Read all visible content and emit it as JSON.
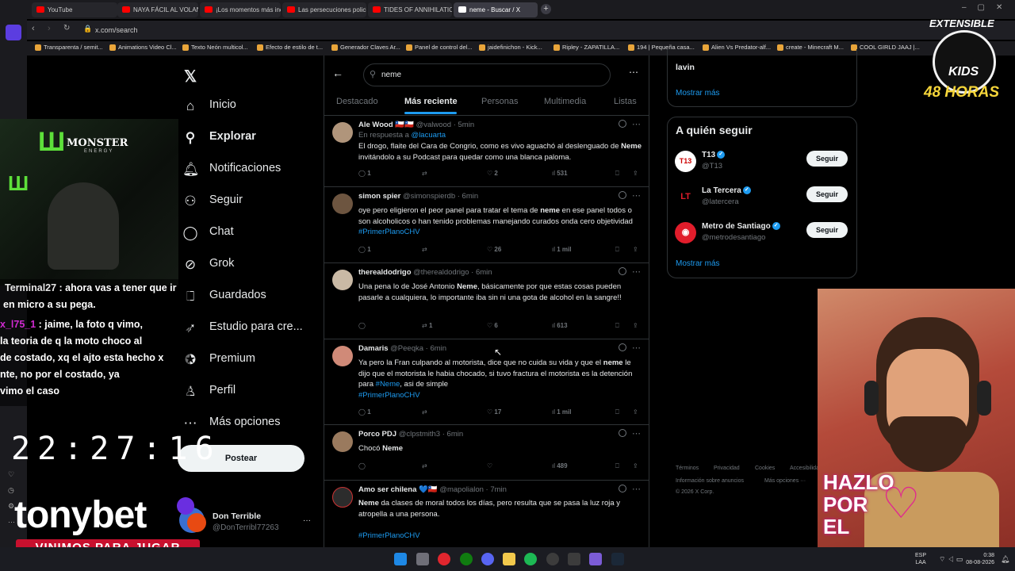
{
  "browser": {
    "tabs": [
      "YouTube",
      "NAYA FÁCIL AL VOLANTE",
      "¡Los momentos más incre",
      "Las persecuciones policial",
      "TIDES OF ANNIHILATION",
      "neme - Buscar / X"
    ],
    "url": "x.com/search",
    "bookmarks": [
      "Transparenta / semit...",
      "Animations Video Cl...",
      "Texto Neón multicol...",
      "Efecto de estilo de t...",
      "Generador Claves Ar...",
      "Panel de control del...",
      "jaidefinichon - Kick...",
      "Ripley - ZAPATILLA...",
      "194 | Pequeña casa...",
      "Alien Vs Predator-alf...",
      "create - Minecraft M...",
      "COOL GIRLD JAAJ |..."
    ]
  },
  "x_nav": {
    "items": [
      {
        "label": "Inicio",
        "icon": "home-icon"
      },
      {
        "label": "Explorar",
        "icon": "search-icon"
      },
      {
        "label": "Notificaciones",
        "icon": "bell-icon"
      },
      {
        "label": "Seguir",
        "icon": "follow-icon"
      },
      {
        "label": "Chat",
        "icon": "chat-icon"
      },
      {
        "label": "Grok",
        "icon": "grok-icon"
      },
      {
        "label": "Guardados",
        "icon": "bookmark-icon"
      },
      {
        "label": "Estudio para cre...",
        "icon": "rocket-icon"
      },
      {
        "label": "Premium",
        "icon": "premium-icon"
      },
      {
        "label": "Perfil",
        "icon": "person-icon"
      },
      {
        "label": "Más opciones",
        "icon": "more-icon"
      }
    ],
    "post_label": "Postear",
    "account_name": "Don Terrible",
    "account_handle": "@DonTerribl77263"
  },
  "search": {
    "query": "neme",
    "tabs": [
      "Destacado",
      "Más reciente",
      "Personas",
      "Multimedia",
      "Listas"
    ],
    "selected_tab": "Más reciente"
  },
  "tweets": [
    {
      "name": "Ale Wood 🇨🇱🇨🇱",
      "handle": "@valwood · 5min",
      "reply_to": "En respuesta a",
      "reply_handle": "@lacuarta",
      "text": "El drogo, flaite del Cara de Congrio, como es vivo aguachó al deslenguado de Neme invitándolo a su Podcast para quedar como una blanca paloma.",
      "replies": "1",
      "retweets": "",
      "likes": "2",
      "views": "531"
    },
    {
      "name": "simon spier",
      "handle": "@simonspierdb · 6min",
      "text": "oye pero eligieron el peor panel para tratar el tema de neme en ese panel todos o son alcoholicos o han tenido problemas manejando curados onda cero objetividad",
      "hashtag": "#PrimerPlanoCHV",
      "replies": "1",
      "retweets": "",
      "likes": "26",
      "views": "1 mil"
    },
    {
      "name": "therealdodrigo",
      "handle": "@therealdodrigo · 6min",
      "text": "Una pena lo de José Antonio Neme, básicamente por que estas cosas pueden pasarle a cualquiera, lo importante iba sin ni una gota de alcohol en la sangre!!",
      "replies": "",
      "retweets": "1",
      "likes": "6",
      "views": "613"
    },
    {
      "name": "Damaris",
      "handle": "@Peeqka · 6min",
      "text": "Ya pero la Fran culpando al motorista, dice que no cuida su vida y que el neme le dijo que el motorista le habia chocado, si tuvo fractura el motorista es la detención para #Neme, asi de simple",
      "hashtag": "#PrimerPlanoCHV",
      "replies": "1",
      "retweets": "",
      "likes": "17",
      "views": "1 mil"
    },
    {
      "name": "Porco PDJ",
      "handle": "@clpstmith3 · 6min",
      "text": "Chocó Neme",
      "replies": "",
      "retweets": "",
      "likes": "",
      "views": "489"
    },
    {
      "name": "Amo ser chilena 💙🇨🇱",
      "handle": "@mapolialon · 7min",
      "text": "Neme da clases de moral todos los días, pero resulta que se pasa la luz roja y atropella a una persona.",
      "hashtag": "#PrimerPlanoCHV"
    }
  ],
  "sidebar": {
    "top_text": "lavin",
    "show_more": "Mostrar más",
    "who_title": "A quién seguir",
    "who": [
      {
        "name": "T13",
        "handle": "@T13",
        "color": "#ffffff"
      },
      {
        "name": "La Tercera",
        "handle": "@latercera",
        "color": "#e11d2b"
      },
      {
        "name": "Metro de Santiago",
        "handle": "@metrodesantiago",
        "color": "#e11d2b"
      }
    ],
    "follow_label": "Seguir",
    "show_more2": "Mostrar más",
    "footer": [
      "Términos",
      "Privacidad",
      "Cookies",
      "Accesibilidad",
      "Información sobre anuncios",
      "Más opciones ···",
      "© 2026 X Corp."
    ]
  },
  "overlay": {
    "chat": [
      {
        "user": "Terminal27",
        "msg": " : ahora vas a tener que ir"
      },
      {
        "user": "",
        "msg": "en micro a su pega."
      },
      {
        "user": "x_l75_1",
        "msg": " : jaime, la foto q vimo,"
      },
      {
        "user": "",
        "msg": "la teoria de q la moto choco al"
      },
      {
        "user": "",
        "msg": "de costado, xq el ajto esta hecho x"
      },
      {
        "user": "",
        "msg": "nte, no por el costado, ya"
      },
      {
        "user": "",
        "msg": "vimo el caso"
      }
    ],
    "clock": "22:27:16",
    "sponsor": "tonybet",
    "sponsor_tag": "VINIMOS PARA JUGAR",
    "monster": "MONSTER",
    "monster_sub": "ENERGY",
    "badge_top": "EXTENSIBLE",
    "badge_mid": "KIDS",
    "badge_bottom": "48 HORAS",
    "hazlo": [
      "HAZLO",
      "POR",
      "EL"
    ]
  },
  "taskbar": {
    "lang": "ESP",
    "lang2": "LAA",
    "time": "0:38",
    "date": "08-08-2026"
  }
}
